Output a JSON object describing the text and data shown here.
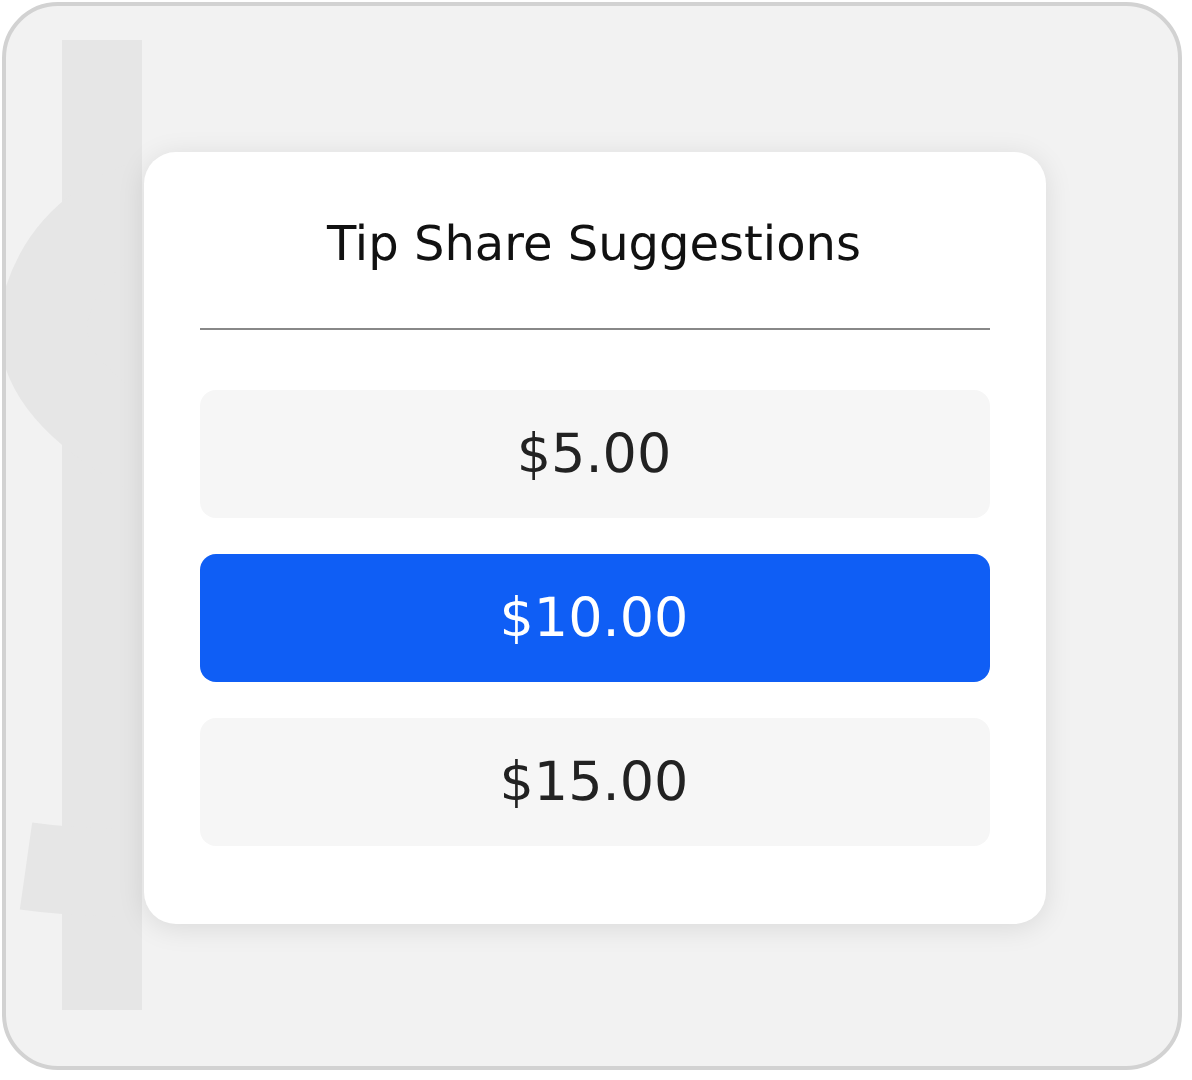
{
  "card": {
    "title": "Tip Share Suggestions",
    "options": [
      {
        "label": "$5.00",
        "selected": false
      },
      {
        "label": "$10.00",
        "selected": true
      },
      {
        "label": "$15.00",
        "selected": false
      }
    ]
  }
}
